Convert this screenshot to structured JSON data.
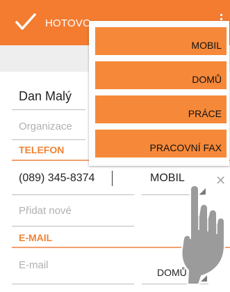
{
  "toolbar": {
    "done_label": "HOTOVO",
    "done_icon": "check-icon",
    "overflow_icon": "overflow-menu-icon",
    "accent": "#f37c31"
  },
  "contact": {
    "name": "Dan Malý",
    "organization_placeholder": "Organizace"
  },
  "phone_section": {
    "title": "TELEFON",
    "number": "(089) 345-8374",
    "type": "MOBIL",
    "add_new_placeholder": "Přidat nové"
  },
  "email_section": {
    "title": "E-MAIL",
    "email_placeholder": "E-mail",
    "type": "DOMŮ"
  },
  "type_menu": {
    "items": [
      "MOBIL",
      "DOMŮ",
      "PRÁCE",
      "PRACOVNÍ FAX"
    ]
  },
  "remove_icon": "close-icon",
  "pointer_icon": "hand-pointer-icon"
}
